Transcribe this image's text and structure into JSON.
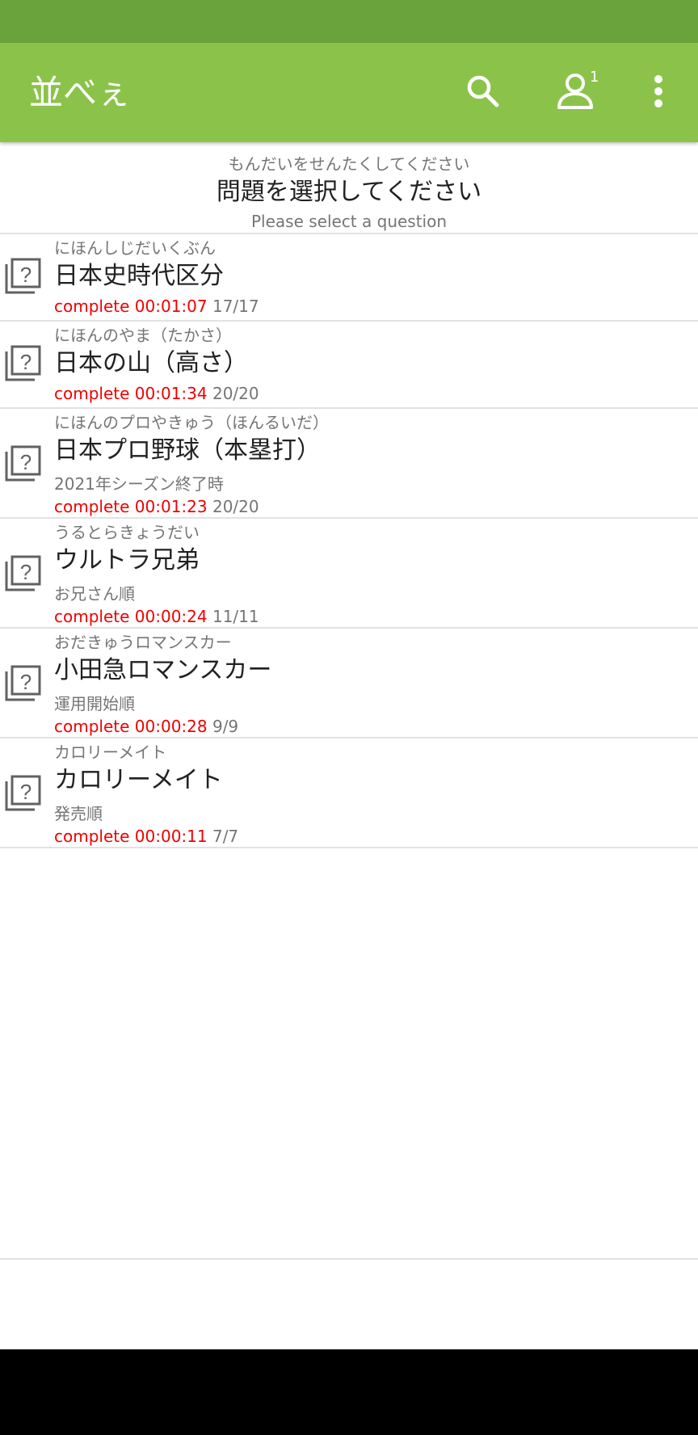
{
  "app": {
    "title": "並べぇ",
    "user_count": "1",
    "colors": {
      "status_bar": "#6aa33c",
      "app_bar": "#8bc34a",
      "complete_text": "#f00000",
      "secondary_text": "#757575"
    },
    "icons": [
      "search-icon",
      "user-icon",
      "more-vert-icon",
      "quiz-stack-icon"
    ]
  },
  "header": {
    "reading": "もんだいをせんたくしてください",
    "title": "問題を選択してください",
    "english": "Please select a question"
  },
  "questions": [
    {
      "reading": "にほんしじだいくぶん",
      "title": "日本史時代区分",
      "subtitle": "",
      "status": "complete 00:01:07",
      "count": "17/17"
    },
    {
      "reading": "にほんのやま（たかさ）",
      "title": "日本の山（高さ）",
      "subtitle": "",
      "status": "complete 00:01:34",
      "count": "20/20"
    },
    {
      "reading": "にほんのプロやきゅう（ほんるいだ）",
      "title": "日本プロ野球（本塁打）",
      "subtitle": "2021年シーズン終了時",
      "status": "complete 00:01:23",
      "count": "20/20"
    },
    {
      "reading": "うるとらきょうだい",
      "title": "ウルトラ兄弟",
      "subtitle": "お兄さん順",
      "status": "complete 00:00:24",
      "count": "11/11"
    },
    {
      "reading": "おだきゅうロマンスカー",
      "title": "小田急ロマンスカー",
      "subtitle": "運用開始順",
      "status": "complete 00:00:28",
      "count": "9/9"
    },
    {
      "reading": "カロリーメイト",
      "title": "カロリーメイト",
      "subtitle": "発売順",
      "status": "complete 00:00:11",
      "count": "7/7"
    }
  ]
}
